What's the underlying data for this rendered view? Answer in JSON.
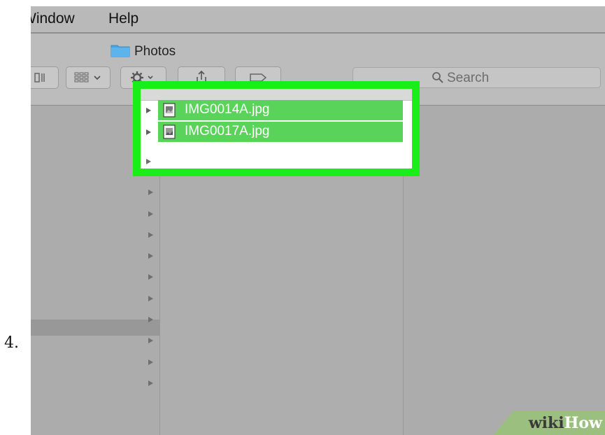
{
  "step": {
    "number": "4."
  },
  "menubar": {
    "items": [
      "Window",
      "Help"
    ]
  },
  "window": {
    "title": "Photos"
  },
  "search": {
    "placeholder": "Search"
  },
  "files": [
    {
      "name": "IMG0014A.jpg",
      "selected": true
    },
    {
      "name": "IMG0017A.jpg",
      "selected": true
    }
  ],
  "watermark": {
    "wiki": "wiki",
    "how": "How"
  },
  "colors": {
    "highlight": "#19ee19",
    "selection": "#5ad35a",
    "folder": "#4aa3df"
  },
  "icons": [
    "folder-icon",
    "column-view-icon",
    "grid-view-icon",
    "gear-icon",
    "share-icon",
    "tag-icon",
    "search-icon",
    "image-file-icon",
    "disclosure-triangle-icon"
  ]
}
